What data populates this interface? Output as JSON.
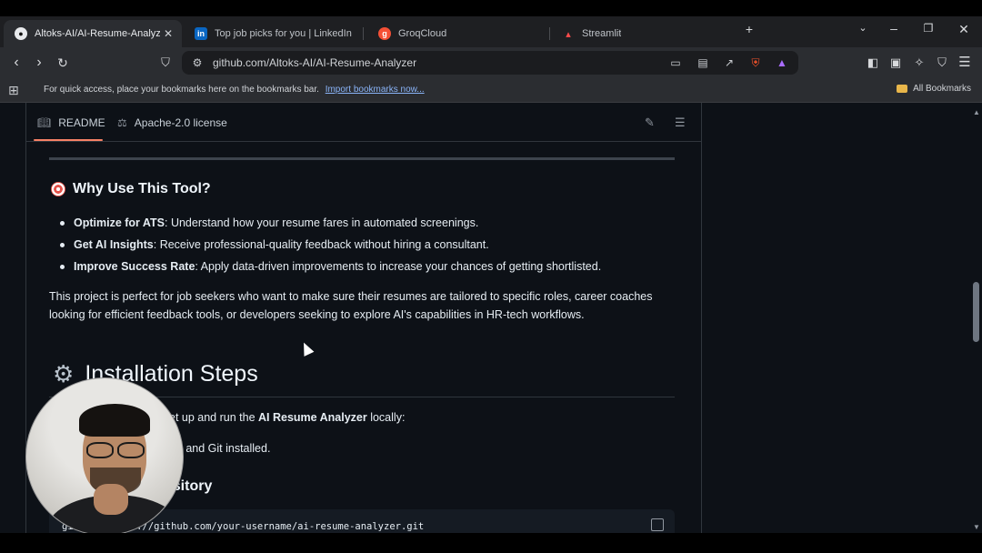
{
  "tabs": [
    {
      "title": "Altoks-AI/AI-Resume-Analyzer",
      "icon": "github-icon",
      "active": true
    },
    {
      "title": "Top job picks for you | LinkedIn",
      "icon": "linkedin-icon"
    },
    {
      "title": "GroqCloud",
      "icon": "groq-icon"
    },
    {
      "title": "Streamlit",
      "icon": "streamlit-icon"
    }
  ],
  "address": {
    "url": "github.com/Altoks-AI/AI-Resume-Analyzer"
  },
  "bookmarks": {
    "hint": "For quick access, place your bookmarks here on the bookmarks bar.",
    "import_link": "Import bookmarks now...",
    "all": "All Bookmarks"
  },
  "readme": {
    "tab_readme": "README",
    "tab_license": "Apache-2.0 license",
    "why_heading": "Why Use This Tool?",
    "bullets": [
      {
        "bold": "Optimize for ATS",
        "text": ": Understand how your resume fares in automated screenings."
      },
      {
        "bold": "Get AI Insights",
        "text": ": Receive professional-quality feedback without hiring a consultant."
      },
      {
        "bold": "Improve Success Rate",
        "text": ": Apply data-driven improvements to increase your chances of getting shortlisted."
      }
    ],
    "paragraph": "This project is perfect for job seekers who want to make sure their resumes are tailored to specific roles, career coaches looking for efficient feedback tools, or developers seeking to explore AI's capabilities in HR-tech workflows.",
    "install_heading": "Installation Steps",
    "setup_prefix": "et up and run the ",
    "setup_bold": "AI Resume Analyzer",
    "setup_suffix": " locally:",
    "python_line": "hon and Git installed.",
    "repo_heading": "ository",
    "code": "git      ttps://github.com/your-username/ai-resume-analyzer.git"
  },
  "colors": {
    "page_bg": "#0d1117",
    "accent": "#f78166",
    "link": "#8ab4f8"
  }
}
